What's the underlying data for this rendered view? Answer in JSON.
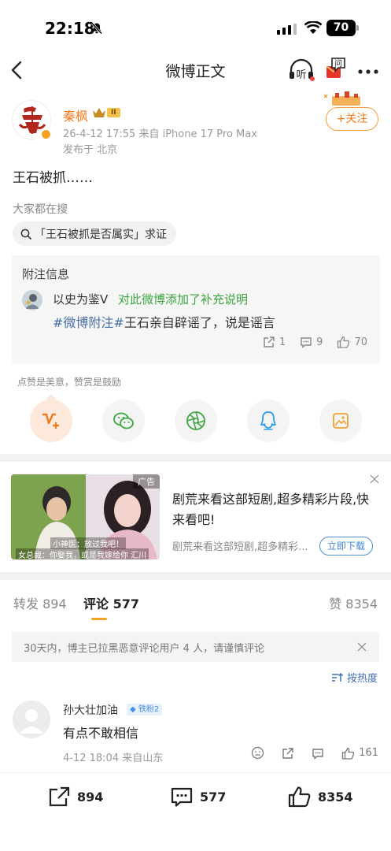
{
  "status_bar": {
    "time": "22:18",
    "battery": "70"
  },
  "nav": {
    "title": "微博正文",
    "listen_label": "听",
    "ask_label": "问"
  },
  "post": {
    "author": "秦枫",
    "badge_level": "II",
    "meta": "26-4-12 17:55  来自 iPhone 17 Pro Max",
    "location": "发布于 北京",
    "follow_label": "+关注",
    "text": "王石被抓……",
    "trend_label": "大家都在搜",
    "trend_query": "「王石被抓是否属实」求证"
  },
  "annotation": {
    "title": "附注信息",
    "author": "以史为鉴Ⅴ",
    "action": "对此微博添加了补充说明",
    "tag": "#微博附注#",
    "text": "王石亲自辟谣了，说是谣言",
    "shares": "1",
    "comments": "9",
    "likes": "70"
  },
  "reward": {
    "caption": "点赞是美意，赞赏是鼓励"
  },
  "ad": {
    "label": "广告",
    "title": "剧荒来看这部短剧,超多精彩片段,快来看吧!",
    "desc": "剧荒来看这部短剧,超多精彩...",
    "download_label": "立即下载",
    "sub1": "小神医：放过我吧！",
    "sub2": "女总裁：你娶我，或是我嫁给你 汇川"
  },
  "tabs": {
    "repost": "转发 894",
    "comments": "评论 577",
    "likes": "赞 8354"
  },
  "notice": "30天内，博主已拉黑恶意评论用户 4 人，请谨慎评论",
  "sort_label": "按热度",
  "comment": {
    "user": "孙大壮加油",
    "fan_badge": "铁粉2",
    "text": "有点不敢相信",
    "meta": "4-12 18:04  来自山东",
    "likes": "161"
  },
  "bottom_bar": {
    "reposts": "894",
    "comments": "577",
    "likes": "8354"
  },
  "colors": {
    "accent": "#f07a1c",
    "green": "#3aa63f",
    "link": "#4a6fa5",
    "badge": "#f7a225"
  }
}
